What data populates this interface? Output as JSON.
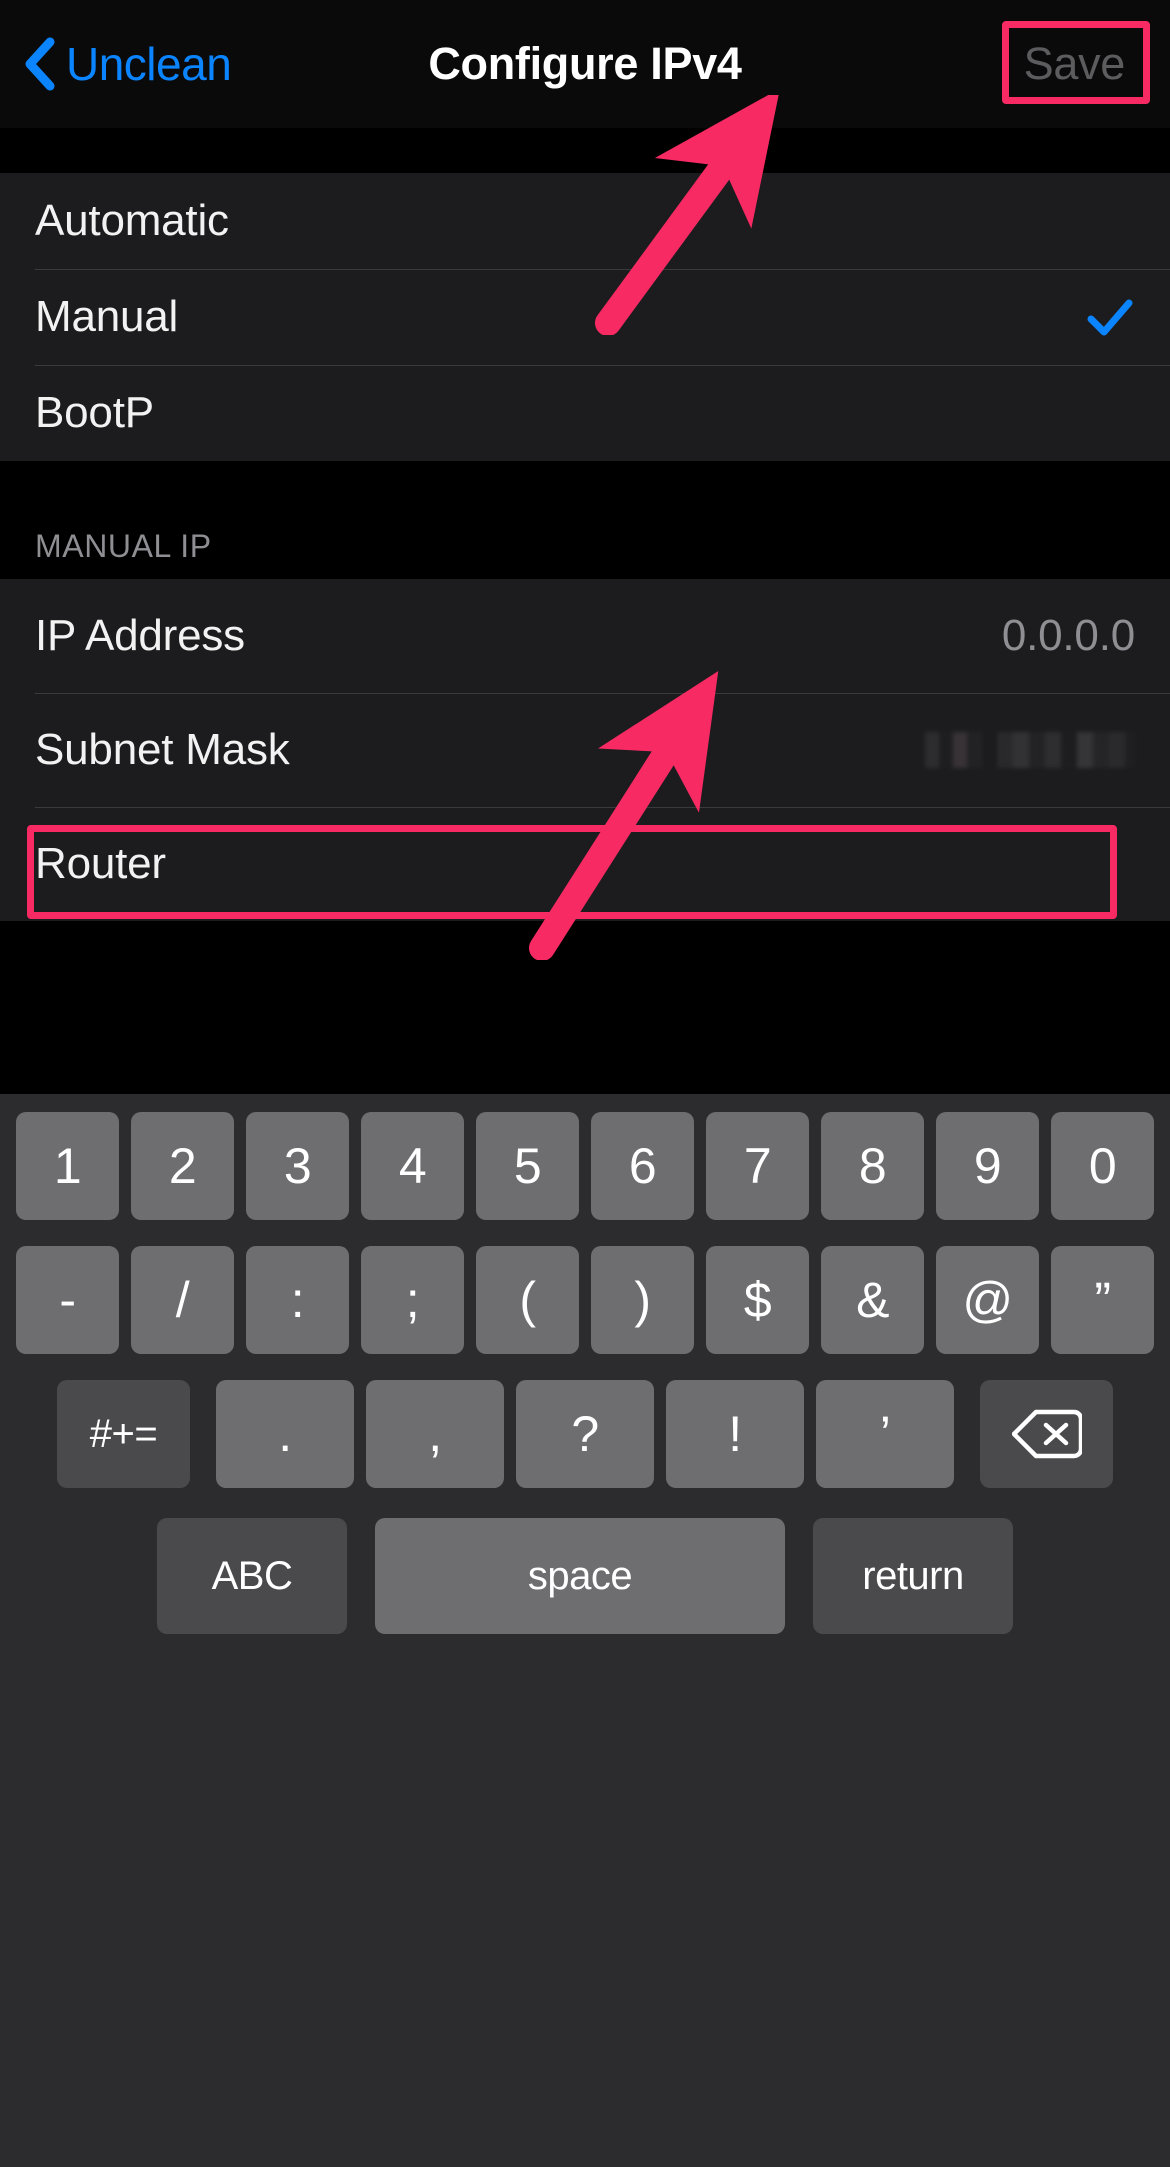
{
  "navbar": {
    "back_label": "Unclean",
    "back_icon": "chevron-left-icon",
    "title": "Configure IPv4",
    "save_label": "Save",
    "save_disabled_color": "#5c5c5e",
    "accent_color": "#0a84ff"
  },
  "config_section": {
    "rows": [
      {
        "label": "Automatic",
        "selected": false
      },
      {
        "label": "Manual",
        "selected": true
      },
      {
        "label": "BootP",
        "selected": false
      }
    ],
    "checkmark_icon": "checkmark-icon",
    "checkmark_color": "#0a84ff"
  },
  "manual_ip_section": {
    "header": "MANUAL IP",
    "rows": [
      {
        "label": "IP Address",
        "value": "0.0.0.0",
        "redacted": false
      },
      {
        "label": "Subnet Mask",
        "value": "",
        "redacted": true
      },
      {
        "label": "Router",
        "value": "",
        "redacted": false
      }
    ]
  },
  "annotations": {
    "color": "#f72a63",
    "items": [
      {
        "name": "save-button-highlight",
        "type": "box"
      },
      {
        "name": "ip-address-row-highlight",
        "type": "box"
      },
      {
        "name": "arrow-to-save",
        "type": "arrow"
      },
      {
        "name": "arrow-to-ip-address",
        "type": "arrow"
      }
    ]
  },
  "keyboard": {
    "type": "numeric-symbols",
    "row1": [
      "1",
      "2",
      "3",
      "4",
      "5",
      "6",
      "7",
      "8",
      "9",
      "0"
    ],
    "row2": [
      "-",
      "/",
      ":",
      ";",
      "(",
      ")",
      "$",
      "&",
      "@",
      "”"
    ],
    "row3": {
      "symbols_toggle": "#+=",
      "keys": [
        ".",
        ",",
        "?",
        "!",
        "’"
      ],
      "delete_icon": "delete-backward-icon"
    },
    "row4": {
      "abc": "ABC",
      "space": "space",
      "return": "return"
    }
  }
}
